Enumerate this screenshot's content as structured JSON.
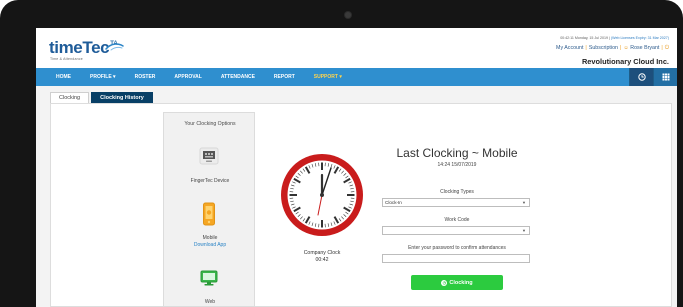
{
  "header": {
    "brand": "timeTec",
    "brand_superscript": "TA",
    "brand_tagline": "Time & Attendance",
    "license_text": "00:42:11 Monday, 15 Jul 2019 | ",
    "license_expiry": "(Web Licenses Expiry: 31 Mar 2027)",
    "account_links": [
      "My Account",
      "Subscription",
      "Rose Bryant"
    ],
    "company": "Revolutionary Cloud Inc.",
    "accent_color": "#f0a020"
  },
  "navbar": {
    "items": [
      "HOME",
      "PROFILE ▾",
      "ROSTER",
      "APPROVAL",
      "ATTENDANCE",
      "REPORT",
      "SUPPORT ▾"
    ],
    "tool_icons": [
      "clock-icon",
      "grid-icon"
    ],
    "bar_color": "#2f8fcf"
  },
  "tabs": [
    "Clocking",
    "Clocking History"
  ],
  "options": {
    "title": "Your Clocking Options",
    "items": [
      {
        "label": "FingerTec Device",
        "link": ""
      },
      {
        "label": "Mobile",
        "link": "Download App"
      },
      {
        "label": "Web",
        "link": ""
      }
    ]
  },
  "company_clock": {
    "label": "Company Clock",
    "time": "00:42"
  },
  "clocking": {
    "title": "Last Clocking ~ Mobile",
    "last_time": "14:24 15/07/2019",
    "type_label": "Clocking Types",
    "type_value": "Clock-In",
    "work_code_label": "Work Code",
    "work_code_value": "",
    "password_label": "Enter your password to confirm attendances",
    "password_value": "",
    "button_label": "Clocking",
    "button_color": "#2ccb3f"
  }
}
